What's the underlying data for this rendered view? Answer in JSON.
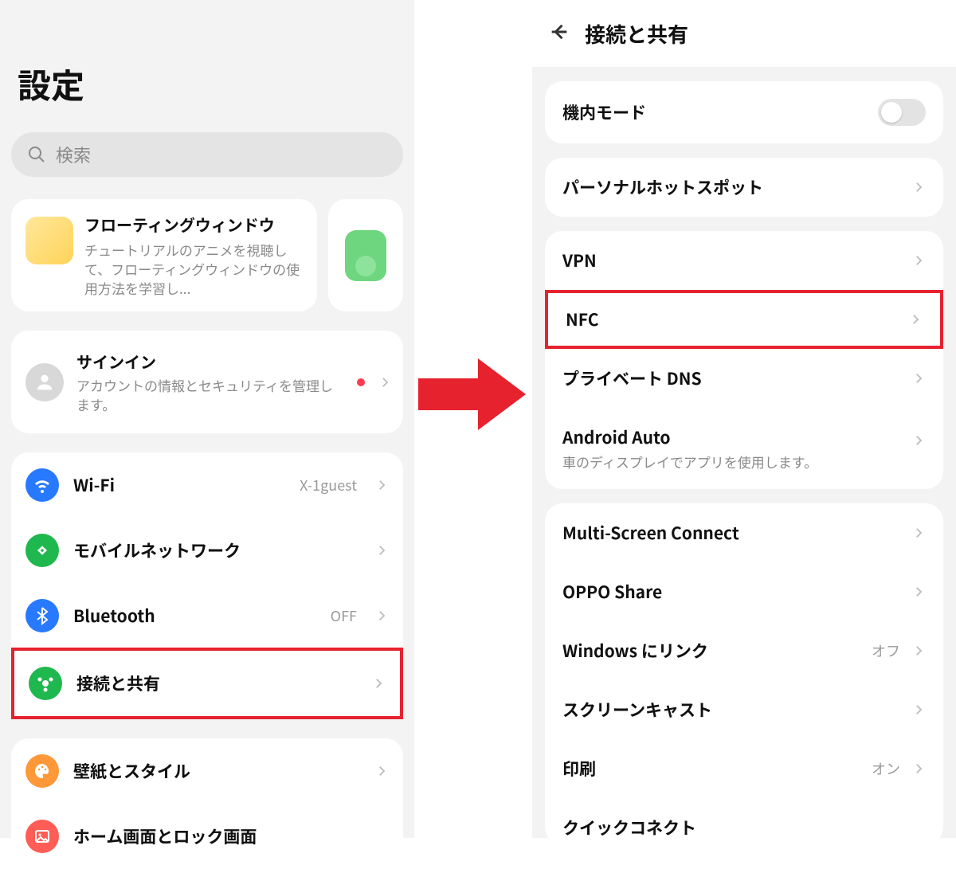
{
  "left": {
    "title": "設定",
    "search_placeholder": "検索",
    "floating_window": {
      "title": "フローティングウィンドウ",
      "desc": "チュートリアルのアニメを視聴して、フローティングウィンドウの使用方法を学習し..."
    },
    "signin": {
      "title": "サインイン",
      "desc": "アカウントの情報とセキュリティを管理します。"
    },
    "rows": {
      "wifi": {
        "label": "Wi-Fi",
        "status": "X-1guest"
      },
      "mobile": {
        "label": "モバイルネットワーク",
        "status": ""
      },
      "bt": {
        "label": "Bluetooth",
        "status": "OFF"
      },
      "share": {
        "label": "接続と共有",
        "status": ""
      },
      "wall": {
        "label": "壁紙とスタイル",
        "status": ""
      },
      "home": {
        "label": "ホーム画面とロック画面",
        "status": ""
      }
    }
  },
  "right": {
    "title": "接続と共有",
    "airplane": {
      "label": "機内モード"
    },
    "hotspot": {
      "label": "パーソナルホットスポット"
    },
    "vpn": {
      "label": "VPN"
    },
    "nfc": {
      "label": "NFC"
    },
    "dns": {
      "label": "プライベート DNS"
    },
    "android_auto": {
      "label": "Android Auto",
      "desc": "車のディスプレイでアプリを使用します。"
    },
    "multiscreen": {
      "label": "Multi-Screen Connect"
    },
    "opposhare": {
      "label": "OPPO Share"
    },
    "winlink": {
      "label": "Windows にリンク",
      "status": "オフ"
    },
    "screencast": {
      "label": "スクリーンキャスト"
    },
    "print": {
      "label": "印刷",
      "status": "オン"
    },
    "quick": {
      "label": "クイックコネクト"
    }
  }
}
